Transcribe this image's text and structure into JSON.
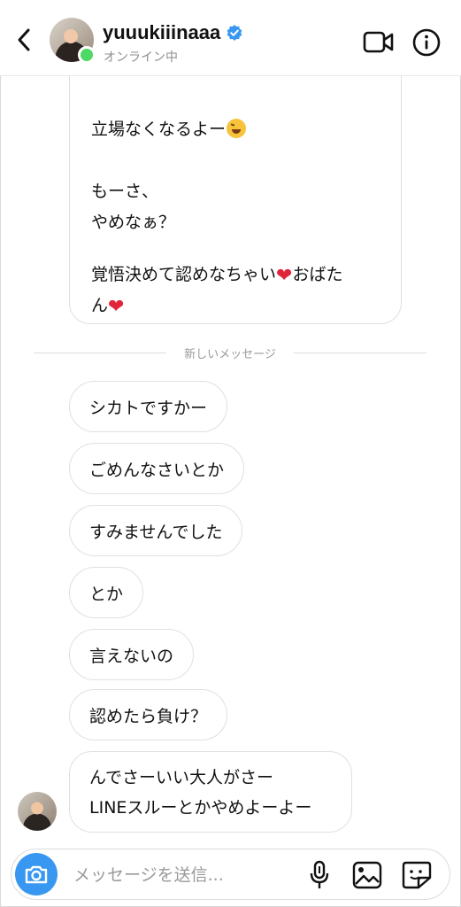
{
  "header": {
    "username": "yuuukiiinaaa",
    "status": "オンライン中",
    "icons": {
      "back": "back-chevron-icon",
      "verified": "verified-badge-icon",
      "video": "video-call-icon",
      "info": "info-icon"
    }
  },
  "thread": {
    "previous_message": {
      "lines": [
        "立場なくなるよー",
        "もーさ、",
        "やめなぁ？",
        "覚悟決めて認めなちゃい",
        "おばた",
        "ん"
      ]
    },
    "divider_label": "新しいメッセージ",
    "messages": [
      "シカトですかー",
      "ごめんなさいとか",
      "すみませんでした",
      "とか",
      "言えないの",
      "認めたら負け？"
    ],
    "last_message": {
      "line1": "んでさーいい大人がさー",
      "line2": "LINEスルーとかやめよーよー"
    }
  },
  "composer": {
    "placeholder": "メッセージを送信...",
    "icons": {
      "camera": "camera-icon",
      "mic": "microphone-icon",
      "gallery": "gallery-icon",
      "sticker": "sticker-icon"
    }
  },
  "colors": {
    "accent": "#3897f0",
    "online": "#4cd964",
    "heart": "#e0243a"
  }
}
